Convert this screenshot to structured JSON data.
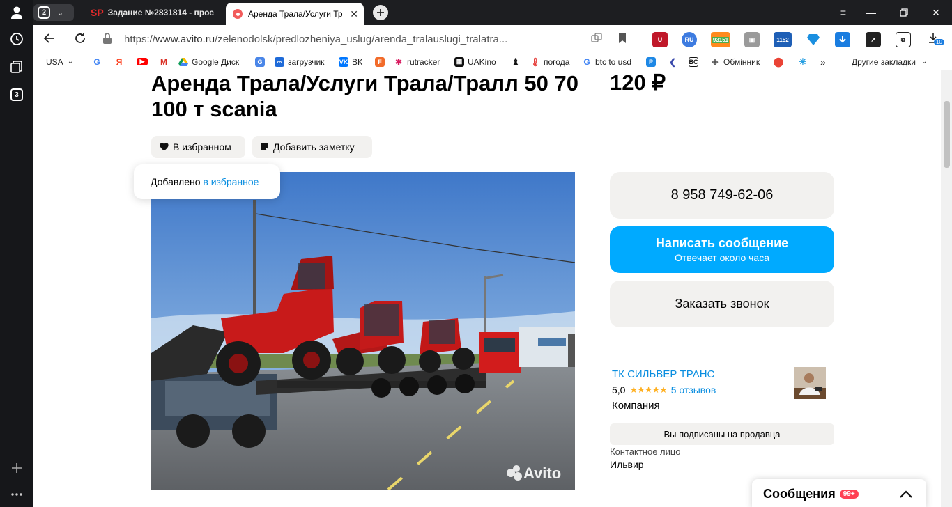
{
  "browser": {
    "tab_count": "2",
    "tabs": [
      {
        "favicon": "SP",
        "label": "Задание №2831814 - прос"
      },
      {
        "label": "Аренда Трала/Услуги Тр"
      }
    ],
    "url": {
      "scheme": "https://",
      "host": "www.avito.ru",
      "path": "/zelenodolsk/predlozheniya_uslug/arenda_tralauslugi_tralatra..."
    },
    "extensions": {
      "badge_93151": "93151",
      "badge_1152": "1152",
      "downloads_count": "10"
    },
    "bookmarks": [
      {
        "label": "USA",
        "icon": "us-flag"
      },
      {
        "label": "",
        "icon": "google-icon"
      },
      {
        "label": "",
        "icon": "yandex-icon"
      },
      {
        "label": "",
        "icon": "youtube-icon"
      },
      {
        "label": "",
        "icon": "gmail-icon"
      },
      {
        "label": "Google Диск",
        "icon": "google-drive-icon"
      },
      {
        "label": "",
        "icon": "google-translate-icon"
      },
      {
        "label": "загрузчик",
        "icon": "cloud-icon"
      },
      {
        "label": "ВК",
        "icon": "vk-icon"
      },
      {
        "label": "",
        "icon": "f-icon"
      },
      {
        "label": "rutracker",
        "icon": "rutracker-icon"
      },
      {
        "label": "UAKino",
        "icon": "uakino-icon"
      },
      {
        "label": "",
        "icon": "chess-icon"
      },
      {
        "label": "погода",
        "icon": "thermometer-icon"
      },
      {
        "label": "btc to usd",
        "icon": "google-icon"
      },
      {
        "label": "",
        "icon": "parking-icon"
      },
      {
        "label": "",
        "icon": "arrow-icon"
      },
      {
        "label": "",
        "icon": "bc-icon"
      },
      {
        "label": "Обмінник",
        "icon": "exchange-icon"
      },
      {
        "label": "",
        "icon": "maps-pin-icon"
      },
      {
        "label": "",
        "icon": "star-burst-icon"
      }
    ],
    "more_bookmarks": "»",
    "other_bookmarks": "Другие закладки"
  },
  "listing": {
    "title": "Аренда Трала/Услуги Трала/Тралл 50 70 100 т scania",
    "price": "120 ₽",
    "favorite_button": "В избранном",
    "note_button": "Добавить заметку",
    "toast_prefix": "Добавлено",
    "toast_link": "в избранное",
    "watermark": "Avito"
  },
  "contact": {
    "phone": "8 958 749-62-06",
    "message_button": "Написать сообщение",
    "message_sub": "Отвечает около часа",
    "callback_button": "Заказать звонок"
  },
  "seller": {
    "name": "ТК СИЛЬВЕР ТРАНС",
    "rating": "5,0",
    "stars": "★★★★★",
    "reviews": "5 отзывов",
    "type": "Компания",
    "subscribed": "Вы подписаны на продавца",
    "contact_label": "Контактное лицо",
    "contact_name": "Ильвир"
  },
  "messages": {
    "label": "Сообщения",
    "badge": "99+"
  },
  "colors": {
    "accent_blue": "#00aaff",
    "link_blue": "#0a8ee0",
    "star": "#ffb021",
    "badge_red": "#ff4053"
  }
}
